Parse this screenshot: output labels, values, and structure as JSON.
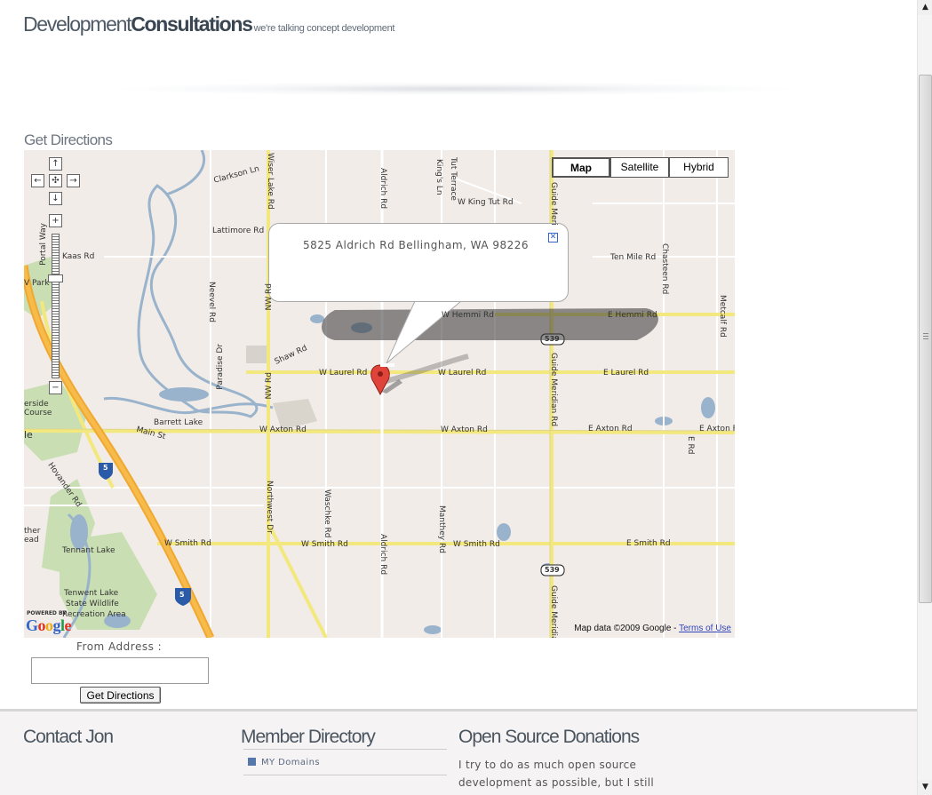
{
  "header": {
    "logo_part1": "Development",
    "logo_part2": "Consultations",
    "tagline": "we're talking concept development"
  },
  "directions": {
    "title": "Get Directions",
    "from_label": "From Address :",
    "from_value": "",
    "button": "Get Directions"
  },
  "map": {
    "type_buttons": [
      "Map",
      "Satellite",
      "Hybrid"
    ],
    "selected_type": "Map",
    "info_window_text": "5825 Aldrich Rd Bellingham, WA 98226",
    "close_glyph": "✕",
    "copyright": "Map data ©2009 Google - ",
    "terms_link": "Terms of Use",
    "powered_by": "POWERED BY",
    "google": "Google",
    "nav_glyphs": {
      "up": "↑",
      "down": "↓",
      "left": "←",
      "right": "→",
      "center": "✣",
      "zoom_in": "+",
      "zoom_out": "−"
    },
    "labels": {
      "clarkson": "Clarkson Ln",
      "wiser": "Wiser Lake Rd",
      "aldrich_top": "Aldrich Rd",
      "kings": "King's Ln",
      "tuttle": "Tut Terrace",
      "wking": "W King Tut Rd",
      "guide_top": "Guide Meri",
      "lattimore": "Lattimore Rd",
      "portal": "Portal Way",
      "kaas": "Kaas Rd",
      "vpark": "V Park",
      "tenmile": "Ten Mile Rd",
      "chasteen": "Chasteen Rd",
      "metcalf": "Metcalf Rd",
      "ehemmi": "E Hemmi Rd",
      "whemmi": "W Hemmi Rd",
      "hwy539a": "539",
      "shaw": "Shaw Rd",
      "paradise": "Paradise Dr",
      "nwrd": "NW Rd",
      "nwrd2": "NW Rd",
      "neevel": "Neevel Rd",
      "wlaurel1": "W Laurel Rd",
      "wlaurel2": "W Laurel Rd",
      "elaurel": "E Laurel Rd",
      "guide_mid": "Guide Meridian Rd",
      "riverside": "erside",
      "course": "Course",
      "barrett": "Barrett Lake",
      "le": "le",
      "mainst": "Main St",
      "waxton1": "W Axton Rd",
      "waxton2": "W Axton Rd",
      "eaxton": "E Axton Rd",
      "eaxton2": "E Axton R",
      "erd": "E Rd",
      "hovander": "Hovander Rd",
      "i5a": "5",
      "northwest": "Northwest Dr",
      "waschke": "Waschke Rd",
      "aldrich_bot": "Aldrich Rd",
      "manthey": "Manthey Rd",
      "wsmith1": "W Smith Rd",
      "wsmith2": "W Smith Rd",
      "wsmith3": "W Smith Rd",
      "esmith": "E Smith Rd",
      "hwy539b": "539",
      "guide_bot": "Guide Meridian",
      "tennant": "Tennant Lake",
      "tennant2": "Lake",
      "ead": "ead",
      "ther": "ther",
      "tenwent": "Tenwent Lake",
      "state": "State Wildlife",
      "recreation": "Recreation Area",
      "i5b": "5",
      "hwy5_top": "5"
    }
  },
  "footer": {
    "contact_heading": "Contact Jon",
    "member_heading": "Member Directory",
    "member_items": [
      "MY Domains"
    ],
    "donations_heading": "Open Source Donations",
    "donations_text": "I try to do as much open source development as possible, but I still need to pay the bills."
  },
  "scrollbar": {
    "up": "▲",
    "down": "▼"
  }
}
